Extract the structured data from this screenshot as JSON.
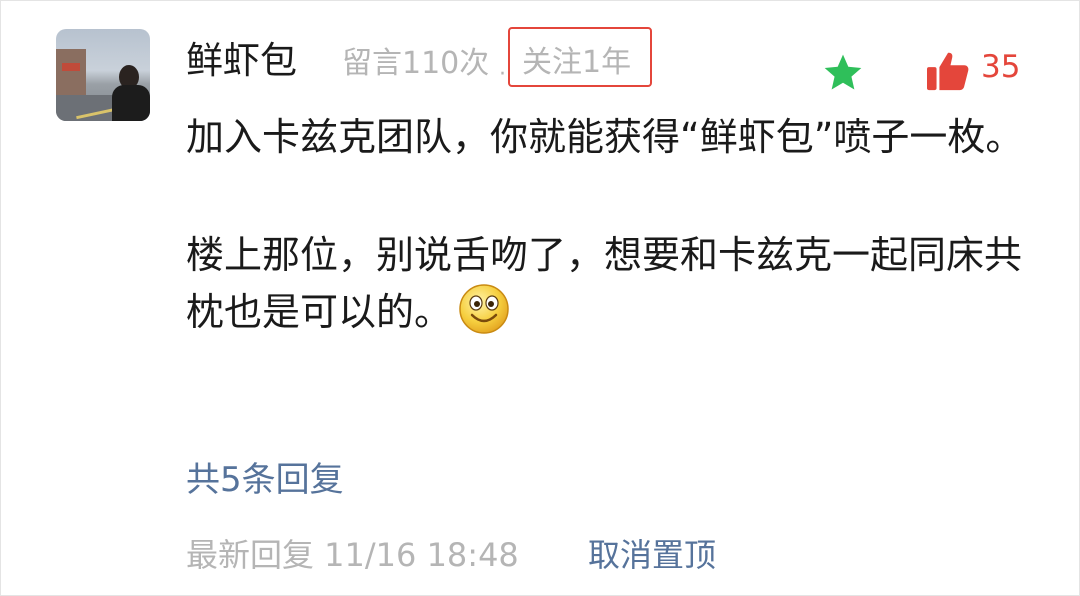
{
  "comment": {
    "username": "鲜虾包",
    "message_count": "留言110次",
    "separator": "·",
    "follow_duration": "关注1年",
    "like_count": "35",
    "body_para1": "加入卡兹克团队，你就能获得“鲜虾包”喷子一枚。",
    "body_para2": "楼上那位，别说舌吻了，想要和卡兹克一起同床共枕也是可以的。",
    "replies_link": "共5条回复",
    "latest_reply": "最新回复 11/16 18:48",
    "unpin_button": "取消置顶"
  },
  "icons": {
    "star": "star-icon",
    "thumb": "thumbs-up-icon",
    "emoji": "smile-emoji-icon"
  },
  "colors": {
    "accent_red": "#e4463b",
    "star_green": "#2fbf5a",
    "link_blue": "#56739b",
    "muted_gray": "#b5b5b5"
  }
}
